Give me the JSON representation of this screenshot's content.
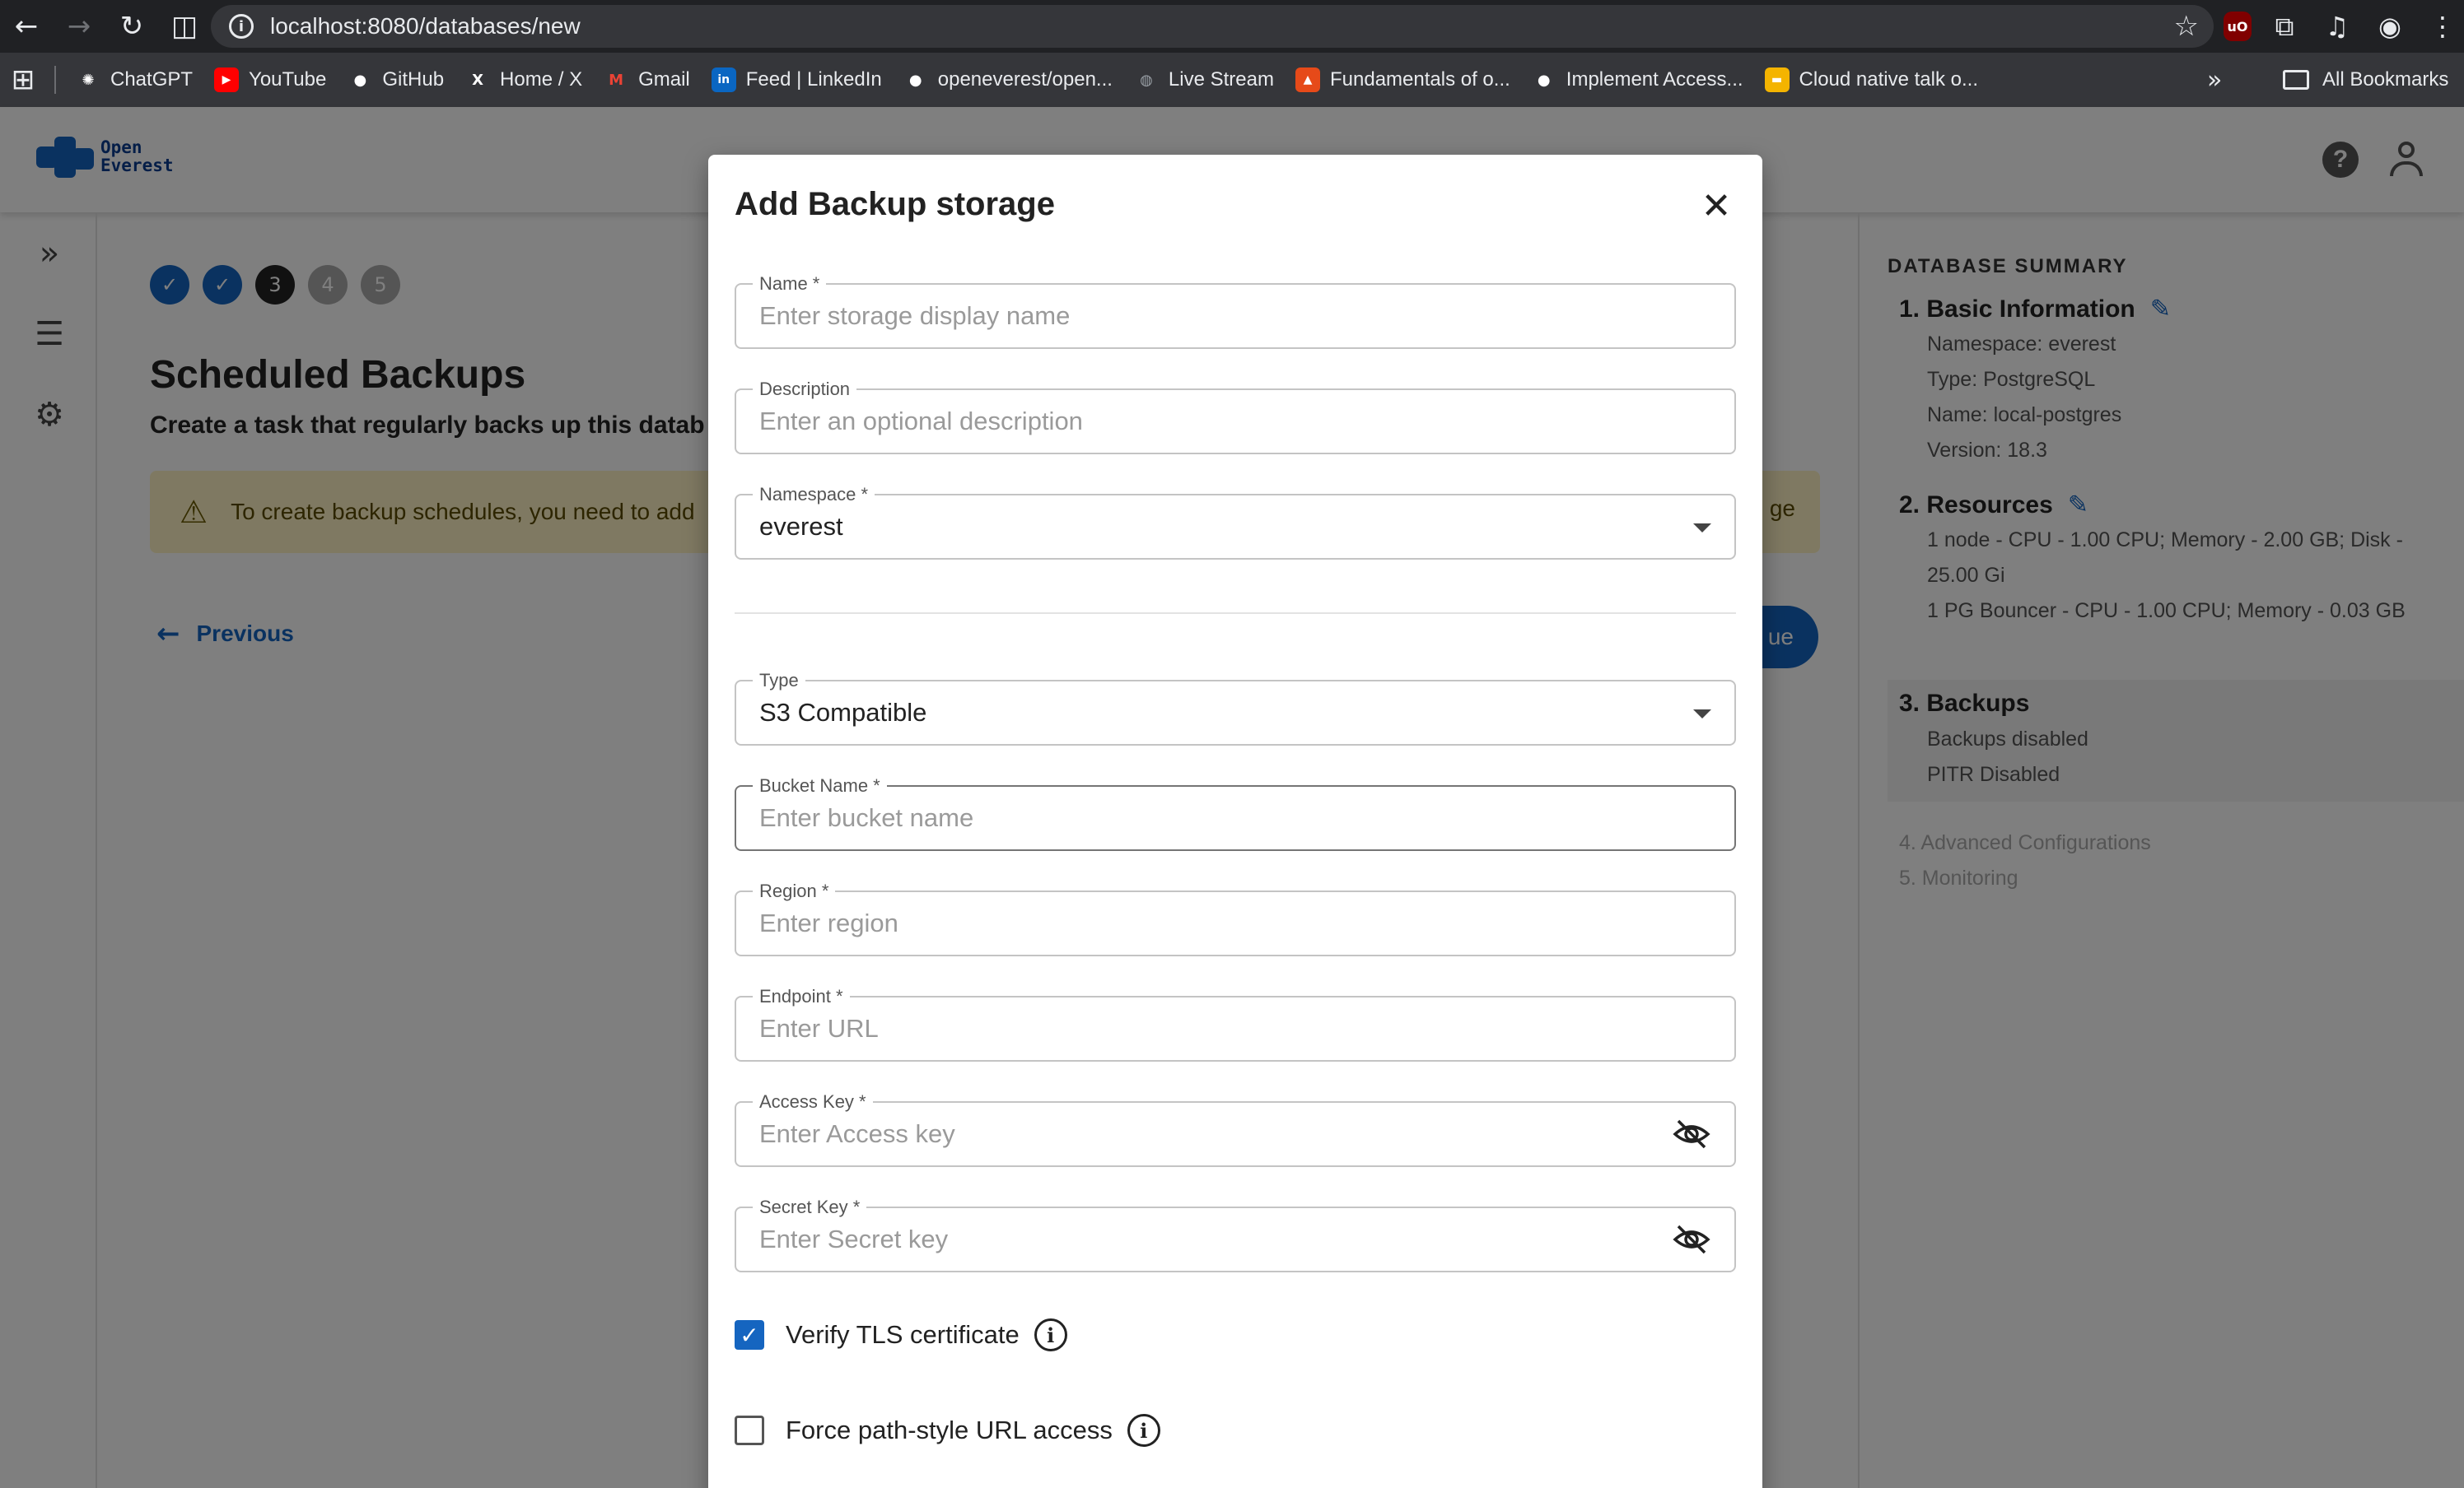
{
  "browser": {
    "url": "localhost:8080/databases/new",
    "bookmarks": [
      {
        "label": "ChatGPT",
        "icon": "chatgpt-icon",
        "color": "#ffffff"
      },
      {
        "label": "YouTube",
        "icon": "youtube-icon",
        "color": "#ff0000"
      },
      {
        "label": "GitHub",
        "icon": "github-icon",
        "color": "#ffffff"
      },
      {
        "label": "Home / X",
        "icon": "x-icon",
        "color": "#ffffff"
      },
      {
        "label": "Gmail",
        "icon": "gmail-icon",
        "color": "#ea4335"
      },
      {
        "label": "Feed | LinkedIn",
        "icon": "linkedin-icon",
        "color": "#0a66c2"
      },
      {
        "label": "openeverest/open...",
        "icon": "github-icon",
        "color": "#ffffff"
      },
      {
        "label": "Live Stream",
        "icon": "globe-icon",
        "color": "#9aa0a6"
      },
      {
        "label": "Fundamentals of o...",
        "icon": "fire-icon",
        "color": "#e64a19"
      },
      {
        "label": "Implement Access...",
        "icon": "github-icon",
        "color": "#ffffff"
      },
      {
        "label": "Cloud native talk o...",
        "icon": "slides-icon",
        "color": "#f4b400"
      }
    ],
    "all_bookmarks": "All Bookmarks"
  },
  "app": {
    "logo_line1": "Open",
    "logo_line2": "Everest",
    "steps": [
      "3",
      "4",
      "5"
    ],
    "title": "Scheduled Backups",
    "subtitle": "Create a task that regularly backs up this datab",
    "alert_text": "To create backup schedules, you need to add",
    "alert_tail": "ge",
    "previous": "Previous",
    "continue_partial": "ue"
  },
  "summary": {
    "title": "DATABASE SUMMARY",
    "basic_title": "1. Basic Information",
    "basic_lines": [
      "Namespace: everest",
      "Type: PostgreSQL",
      "Name: local-postgres",
      "Version: 18.3"
    ],
    "resources_title": "2. Resources",
    "resources_lines": [
      "1 node - CPU - 1.00 CPU; Memory - 2.00 GB; Disk -",
      "25.00 Gi",
      "1 PG Bouncer - CPU - 1.00 CPU; Memory - 0.03 GB"
    ],
    "backups_title": "3. Backups",
    "backups_lines": [
      "Backups disabled",
      "PITR Disabled"
    ],
    "advanced": "4. Advanced Configurations",
    "monitoring": "5. Monitoring"
  },
  "modal": {
    "title": "Add Backup storage",
    "name": {
      "label": "Name *",
      "placeholder": "Enter storage display name",
      "value": ""
    },
    "description": {
      "label": "Description",
      "placeholder": "Enter an optional description",
      "value": ""
    },
    "namespace": {
      "label": "Namespace *",
      "value": "everest"
    },
    "type": {
      "label": "Type",
      "value": "S3 Compatible"
    },
    "bucket": {
      "label": "Bucket Name *",
      "placeholder": "Enter bucket name",
      "value": ""
    },
    "region": {
      "label": "Region *",
      "placeholder": "Enter region",
      "value": ""
    },
    "endpoint": {
      "label": "Endpoint *",
      "placeholder": "Enter URL",
      "value": ""
    },
    "access_key": {
      "label": "Access Key *",
      "placeholder": "Enter Access key",
      "value": ""
    },
    "secret_key": {
      "label": "Secret Key *",
      "placeholder": "Enter Secret key",
      "value": ""
    },
    "verify_tls": {
      "label": "Verify TLS certificate",
      "checked": true
    },
    "force_path": {
      "label": "Force path-style URL access",
      "checked": false
    }
  },
  "colors": {
    "accent": "#1565c0",
    "alert_bg": "#fff3c4"
  }
}
